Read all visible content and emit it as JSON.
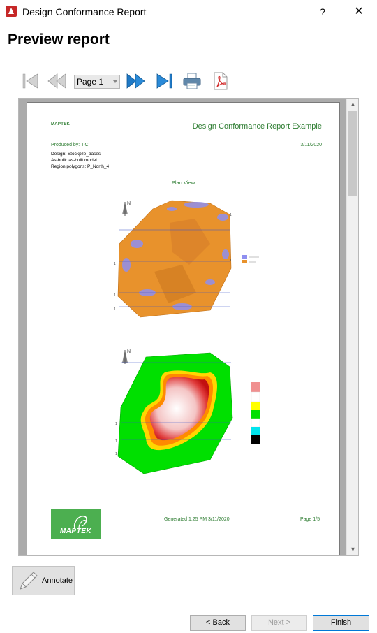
{
  "window": {
    "title": "Design Conformance Report",
    "help_label": "?",
    "close_label": "✕"
  },
  "heading": "Preview report",
  "toolbar": {
    "page_select_value": "Page 1"
  },
  "report": {
    "logo_text": "MAPTEK",
    "title": "Design Conformance Report Example",
    "produced_by": "Produced by: T.C.",
    "date": "3/11/2020",
    "design": "Design: Stockpile_bases",
    "as_built": "As-built: as-built model",
    "region_polygons": "Region polygons: P_North_4",
    "plan_view": "Plan View",
    "generated": "Generated 1:25 PM 3/11/2020",
    "page": "Page 1/5",
    "footer_logo_text": "MAPTEK"
  },
  "buttons": {
    "annotate": "Annotate",
    "back": "< Back",
    "next": "Next >",
    "finish": "Finish"
  },
  "colors": {
    "accent_green": "#2e7d32",
    "finish_border": "#0078d7",
    "logo_green": "#4caf50"
  }
}
